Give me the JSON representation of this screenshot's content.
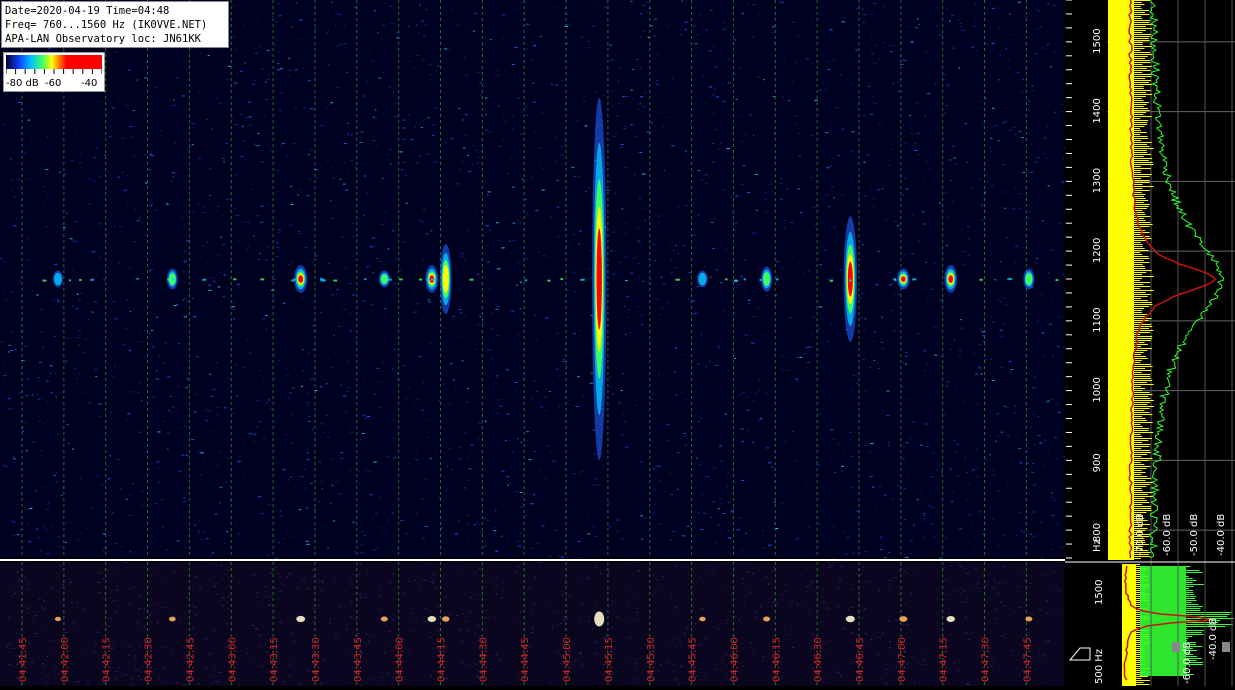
{
  "header": {
    "date_time": "Date=2020-04-19 Time=04:48",
    "frequency": "Freq= 760...1560 Hz (IK0VVE.NET)",
    "observatory": "APA-LAN Observatory loc: JN61KK"
  },
  "colorbar": {
    "labels": [
      "-80 dB",
      "-60",
      "-40"
    ],
    "colors": [
      "#000030",
      "#1040ff",
      "#00c0ff",
      "#40ff60",
      "#ffff00",
      "#ff8000",
      "#ff0000"
    ]
  },
  "colors": {
    "background": "#000000",
    "grid_vertical": "#2a8a2a",
    "time_label": "#dd2222",
    "spectrum_noise": "#ffff00",
    "spectrum_avg": "#cc1111",
    "spectrum_peak": "#33ff33"
  },
  "chart_data": [
    {
      "type": "heatmap",
      "name": "waterfall",
      "y_range_hz": [
        760,
        1560
      ],
      "y_ticks_hz": [
        800,
        900,
        1000,
        1100,
        1200,
        1300,
        1400,
        1500
      ],
      "y_unit": "Hz",
      "carrier_hz": 1160,
      "x_time_labels": [
        "04:41:45",
        "04:42:00",
        "04:42:15",
        "04:42:30",
        "04:42:45",
        "04:43:00",
        "04:43:15",
        "04:43:30",
        "04:43:45",
        "04:44:00",
        "04:44:15",
        "04:44:30",
        "04:44:45",
        "04:45:00",
        "04:45:15",
        "04:45:30",
        "04:45:45",
        "04:46:00",
        "04:46:15",
        "04:46:30",
        "04:46:45",
        "04:47:00",
        "04:47:15",
        "04:47:30",
        "04:47:45"
      ],
      "color_scale_db": [
        -80,
        -40
      ],
      "events": [
        {
          "time_s": 24,
          "intensity": 0.35,
          "spread_hz": 12
        },
        {
          "time_s": 65,
          "intensity": 0.45,
          "spread_hz": 15
        },
        {
          "time_s": 111,
          "intensity": 0.8,
          "spread_hz": 20
        },
        {
          "time_s": 141,
          "intensity": 0.5,
          "spread_hz": 12
        },
        {
          "time_s": 158,
          "intensity": 0.75,
          "spread_hz": 20
        },
        {
          "time_s": 163,
          "intensity": 0.6,
          "spread_hz": 50
        },
        {
          "time_s": 218,
          "intensity": 1.0,
          "spread_hz": 260
        },
        {
          "time_s": 255,
          "intensity": 0.4,
          "spread_hz": 12
        },
        {
          "time_s": 278,
          "intensity": 0.5,
          "spread_hz": 18
        },
        {
          "time_s": 308,
          "intensity": 0.85,
          "spread_hz": 90
        },
        {
          "time_s": 327,
          "intensity": 0.7,
          "spread_hz": 15
        },
        {
          "time_s": 344,
          "intensity": 0.75,
          "spread_hz": 20
        },
        {
          "time_s": 372,
          "intensity": 0.5,
          "spread_hz": 15
        },
        {
          "time_s": 460,
          "intensity": 0.45,
          "spread_hz": 15
        },
        {
          "time_s": 513,
          "intensity": 0.5,
          "spread_hz": 15
        },
        {
          "time_s": 526,
          "intensity": 0.4,
          "spread_hz": 12
        },
        {
          "time_s": 586,
          "intensity": 0.55,
          "spread_hz": 15
        },
        {
          "time_s": 601,
          "intensity": 0.7,
          "spread_hz": 15
        }
      ],
      "persistent_band": {
        "time_s_start": 407,
        "time_s_end": 428
      }
    },
    {
      "type": "line",
      "name": "spectrum_profile",
      "x_unit": "dB",
      "x_tick_labels": [
        "-70.0 dB",
        "-60.0 dB",
        "-50.0 dB",
        "-40.0 dB"
      ],
      "y_ticks_hz": [
        800,
        900,
        1000,
        1100,
        1200,
        1300,
        1400,
        1500
      ],
      "series": [
        {
          "color": "#ffff00",
          "peak_hz": 1160
        },
        {
          "color": "#cc1111",
          "peak_hz": 1160
        },
        {
          "color": "#33ff33",
          "peak_hz": 1160
        }
      ]
    },
    {
      "type": "heatmap",
      "name": "bottom_waterfall",
      "y_tick_labels": [
        "1500",
        "500 Hz"
      ],
      "x_tick_labels": [
        "-60.0 dB",
        "-40.0 dB"
      ]
    }
  ]
}
